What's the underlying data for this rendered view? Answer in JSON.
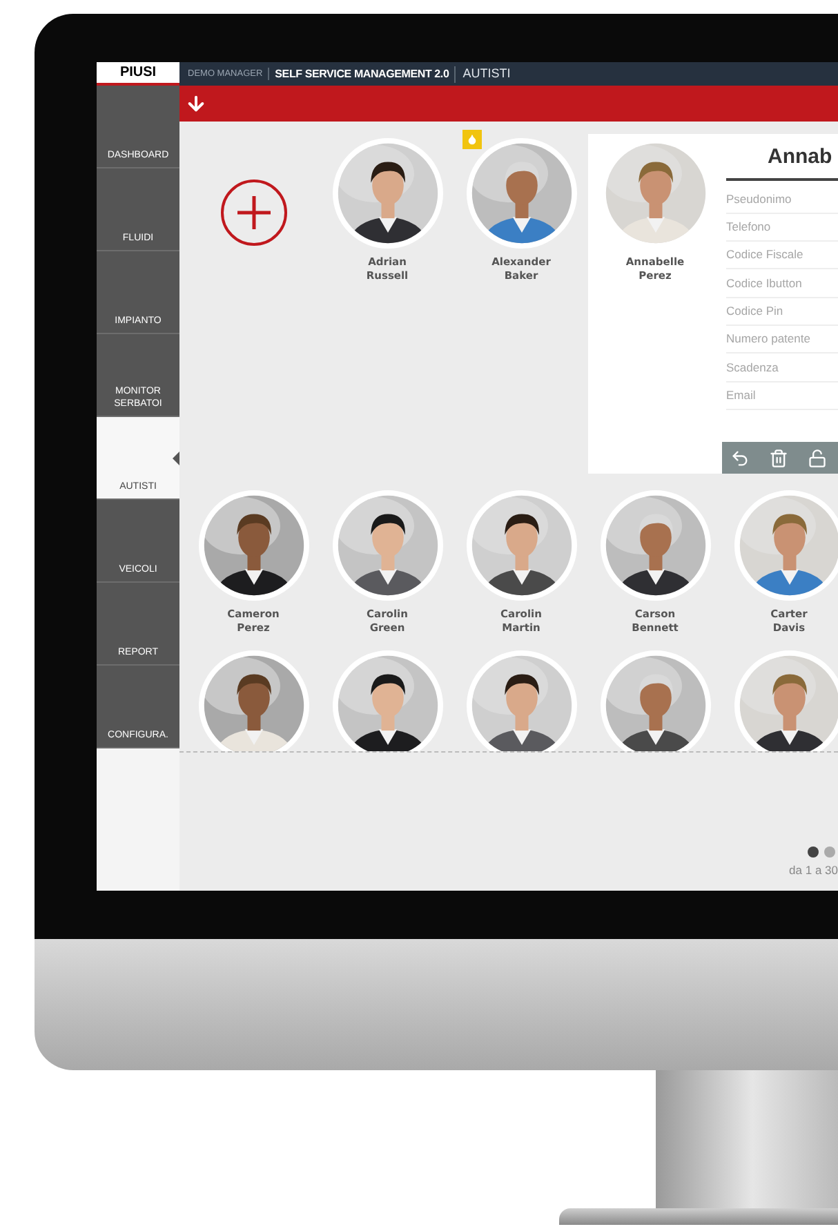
{
  "header": {
    "logo": "PIUSI",
    "account": "DEMO MANAGER",
    "app_title": "SELF SERVICE MANAGEMENT 2.0",
    "section": "AUTISTI"
  },
  "sidebar": {
    "items": [
      {
        "label": "DASHBOARD",
        "selected": false
      },
      {
        "label": "FLUIDI",
        "selected": false
      },
      {
        "label": "IMPIANTO",
        "selected": false
      },
      {
        "label": "MONITOR SERBATOI",
        "selected": false
      },
      {
        "label": "AUTISTI",
        "selected": true
      },
      {
        "label": "VEICOLI",
        "selected": false
      },
      {
        "label": "REPORT",
        "selected": false
      },
      {
        "label": "CONFIGURA.",
        "selected": false
      }
    ]
  },
  "drivers": [
    [
      {
        "name": "Adrian Russell",
        "selected": false,
        "badge": false
      },
      {
        "name": "Alexander Baker",
        "selected": false,
        "badge": true
      },
      {
        "name": "Annabelle Perez",
        "selected": true,
        "badge": false
      }
    ],
    [
      {
        "name": "Cameron Perez",
        "selected": false,
        "badge": false
      },
      {
        "name": "Carolin Green",
        "selected": false,
        "badge": false
      },
      {
        "name": "Carolin Martin",
        "selected": false,
        "badge": false
      },
      {
        "name": "Carson Bennett",
        "selected": false,
        "badge": false
      },
      {
        "name": "Carter Davis",
        "selected": false,
        "badge": false
      }
    ],
    [
      {
        "selected": false,
        "badge": false
      },
      {
        "selected": false,
        "badge": false
      },
      {
        "selected": false,
        "badge": false
      },
      {
        "selected": false,
        "badge": false
      },
      {
        "selected": false,
        "badge": false
      }
    ]
  ],
  "detail": {
    "title": "Annab",
    "fields": [
      "Pseudonimo",
      "Telefono",
      "Codice Fiscale",
      "Codice Ibutton",
      "Codice Pin",
      "Numero patente",
      "Scadenza",
      "Email"
    ]
  },
  "pagination": {
    "pages": [
      {
        "selected": true
      },
      {
        "selected": false
      }
    ],
    "range": "da 1 a 30"
  }
}
